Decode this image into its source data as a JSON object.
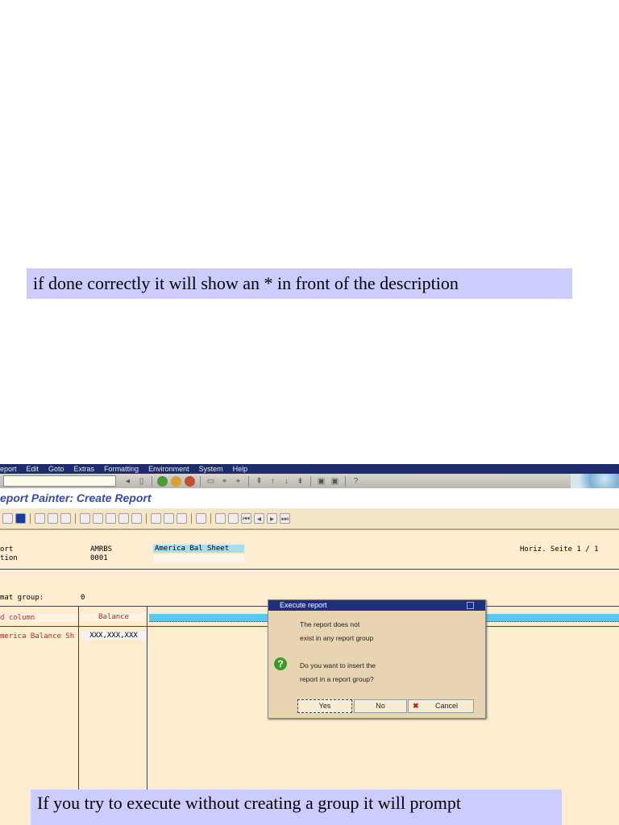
{
  "notes": {
    "top": "if done correctly it will show an * in front of the description",
    "bottom": "If you try to execute without creating a group it will prompt"
  },
  "menu": [
    "eport",
    "Edit",
    "Goto",
    "Extras",
    "Formatting",
    "Environment",
    "System",
    "Help"
  ],
  "title": "eport Painter: Create Report",
  "header": {
    "label1": "ort",
    "value1": "AMRBS",
    "desc": "America Bal Sheet",
    "label2": "tion",
    "value2": "0001",
    "page_info": "Horiz. Seite  1  /  1"
  },
  "format": {
    "label": "mat group:",
    "value": "0"
  },
  "grid": {
    "col_header": "d column",
    "balance": "Balance",
    "row_label": "merica Balance Sh",
    "row_value": "XXX,XXX,XXX"
  },
  "dialog": {
    "title": "Execute report",
    "line1": "The report does not",
    "line2": "exist in any report group",
    "line3": "Do you want to insert the",
    "line4": "report in a report group?",
    "yes": "Yes",
    "no": "No",
    "cancel": "Cancel"
  }
}
